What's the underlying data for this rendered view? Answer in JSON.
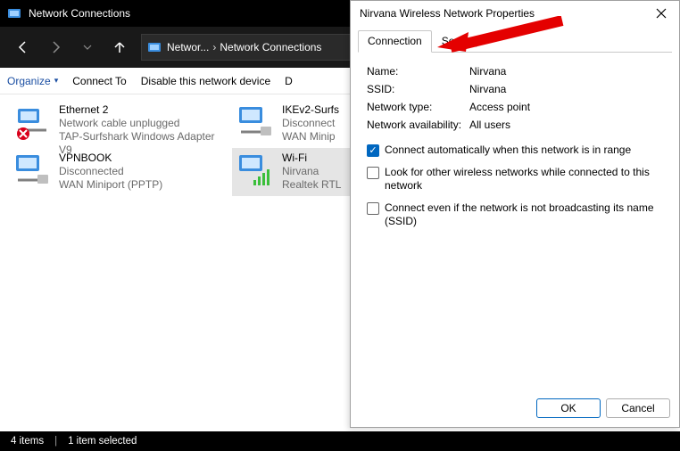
{
  "window": {
    "title": "Network Connections"
  },
  "breadcrumb": {
    "part1": "Networ...",
    "part2": "Network Connections"
  },
  "toolbar": {
    "organize": "Organize",
    "connect_to": "Connect To",
    "disable": "Disable this network device",
    "diagnose": "D"
  },
  "items": [
    {
      "name": "Ethernet 2",
      "status": "Network cable unplugged",
      "device": "TAP-Surfshark Windows Adapter V9",
      "iconType": "ethernet-unplugged"
    },
    {
      "name": "IKEv2-Surfs",
      "status": "Disconnect",
      "device": "WAN Minip",
      "iconType": "wan"
    },
    {
      "name": "VPNBOOK",
      "status": "Disconnected",
      "device": "WAN Miniport (PPTP)",
      "iconType": "wan"
    },
    {
      "name": "Wi-Fi",
      "status": "Nirvana",
      "device": "Realtek RTL",
      "iconType": "wifi",
      "selected": true
    }
  ],
  "status": {
    "count": "4 items",
    "selected": "1 item selected"
  },
  "dialog": {
    "title": "Nirvana Wireless Network Properties",
    "tabs": {
      "connection": "Connection",
      "security": "Security"
    },
    "fields": {
      "name_label": "Name:",
      "name_value": "Nirvana",
      "ssid_label": "SSID:",
      "ssid_value": "Nirvana",
      "type_label": "Network type:",
      "type_value": "Access point",
      "avail_label": "Network availability:",
      "avail_value": "All users"
    },
    "checks": {
      "auto": "Connect automatically when this network is in range",
      "look": "Look for other wireless networks while connected to this network",
      "hidden": "Connect even if the network is not broadcasting its name (SSID)"
    },
    "buttons": {
      "ok": "OK",
      "cancel": "Cancel"
    }
  }
}
